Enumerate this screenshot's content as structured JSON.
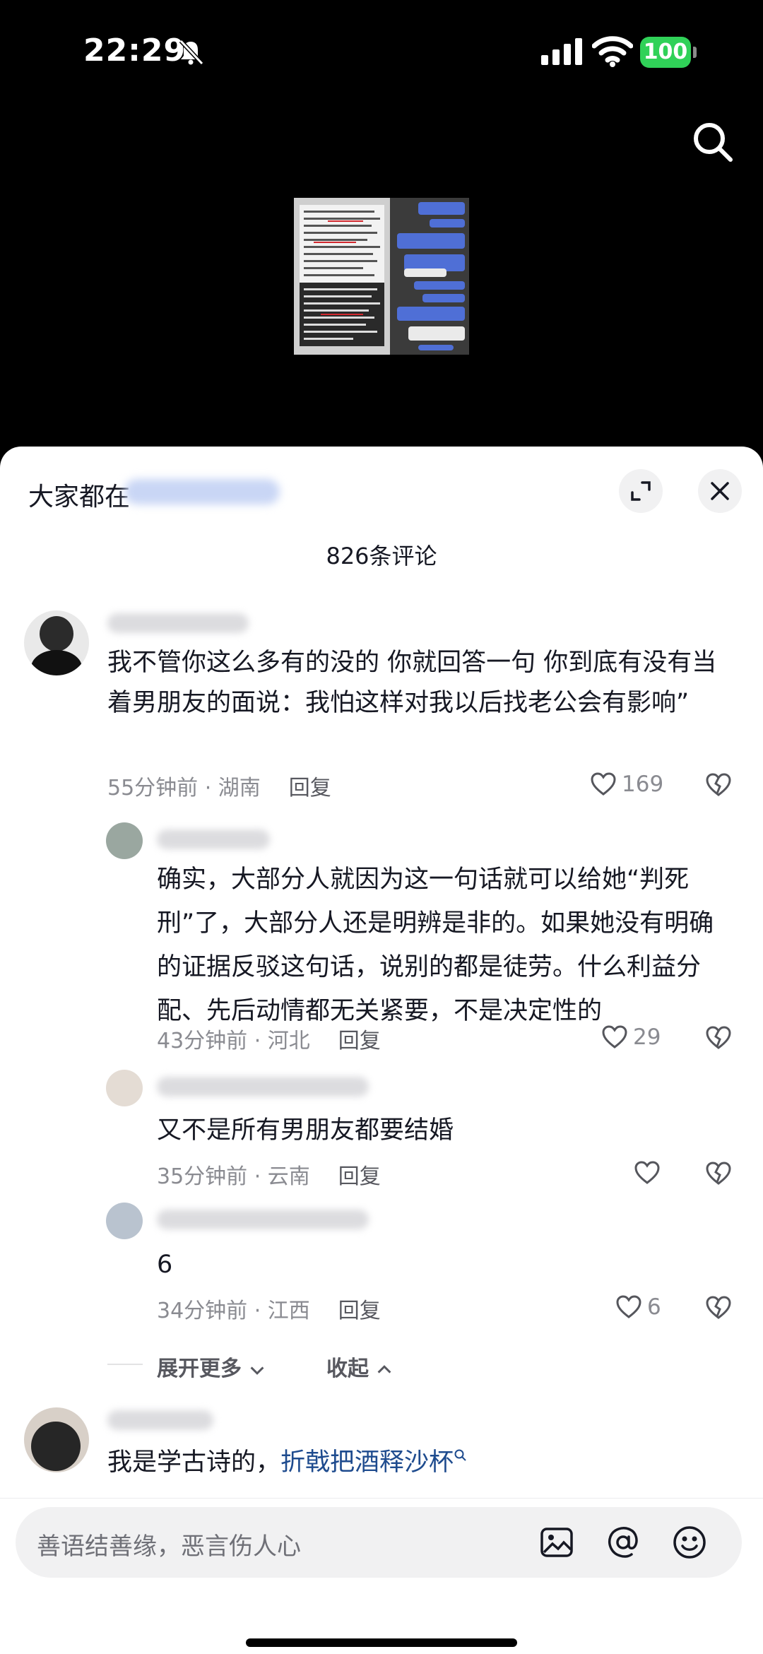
{
  "status": {
    "time": "22:29",
    "battery": "100",
    "icons": [
      "bell-slash-icon",
      "signal-icon",
      "wifi-icon",
      "battery-icon"
    ]
  },
  "video": {
    "icons": [
      "search-icon"
    ]
  },
  "sheet": {
    "title": "大家都在",
    "comment_count": "826条评论",
    "icons": [
      "expand-icon",
      "close-icon"
    ]
  },
  "comments": [
    {
      "text": "我不管你这么多有的没的 你就回答一句 你到底有没有当着男朋友的面说：我怕这样对我以后找老公会有影响”",
      "meta": "55分钟前 · 湖南",
      "reply": "回复",
      "likes": "169"
    },
    {
      "text": "确实，大部分人就因为这一句话就可以给她“判死刑”了，大部分人还是明辨是非的。如果她没有明确的证据反驳这句话，说别的都是徒劳。什么利益分配、先后动情都无关紧要，不是决定性的",
      "meta": "43分钟前 · 河北",
      "reply": "回复",
      "likes": "29"
    },
    {
      "text": "又不是所有男朋友都要结婚",
      "meta": "35分钟前 · 云南",
      "reply": "回复",
      "likes": ""
    },
    {
      "text": "6",
      "meta": "34分钟前 · 江西",
      "reply": "回复",
      "likes": "6"
    }
  ],
  "thread": {
    "expand_more": "展开更多",
    "collapse": "收起"
  },
  "last_comment": {
    "text_prefix": "我是学古诗的，",
    "link_text": "折戟把酒释沙杯"
  },
  "input": {
    "placeholder": "善语结善缘，恶言伤人心",
    "icons": [
      "image-icon",
      "at-icon",
      "emoji-icon"
    ]
  },
  "colors": {
    "battery": "#30d158",
    "link": "#1e4b8e",
    "secondary_text": "#8a8b91"
  }
}
